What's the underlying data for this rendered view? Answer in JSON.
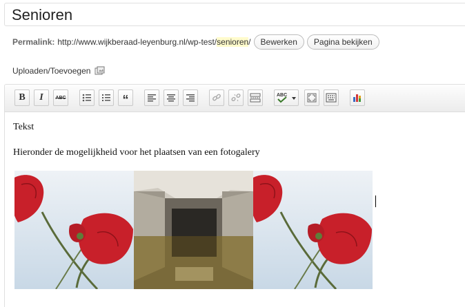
{
  "post": {
    "title": "Senioren"
  },
  "permalink": {
    "label": "Permalink:",
    "url_base": "http://www.wijkberaad-leyenburg.nl/wp-test/",
    "slug": "senioren",
    "trailing_slash": "/",
    "edit_button": "Bewerken",
    "view_button": "Pagina bekijken"
  },
  "upload": {
    "label": "Uploaden/Toevoegen",
    "icon": "media-upload-icon"
  },
  "toolbar": {
    "buttons": [
      {
        "name": "bold-button",
        "icon": "bold-icon",
        "glyph": "B"
      },
      {
        "name": "italic-button",
        "icon": "italic-icon",
        "glyph": "I"
      },
      {
        "name": "strikethrough-button",
        "icon": "strikethrough-icon",
        "glyph": "ABC"
      },
      {
        "name": "bullet-list-button",
        "icon": "bullet-list-icon"
      },
      {
        "name": "numbered-list-button",
        "icon": "numbered-list-icon"
      },
      {
        "name": "blockquote-button",
        "icon": "blockquote-icon",
        "glyph": "“"
      },
      {
        "name": "align-left-button",
        "icon": "align-left-icon"
      },
      {
        "name": "align-center-button",
        "icon": "align-center-icon"
      },
      {
        "name": "align-right-button",
        "icon": "align-right-icon"
      },
      {
        "name": "insert-link-button",
        "icon": "link-icon"
      },
      {
        "name": "remove-link-button",
        "icon": "unlink-icon"
      },
      {
        "name": "insert-more-button",
        "icon": "more-tag-icon"
      },
      {
        "name": "spellcheck-button",
        "icon": "spellcheck-icon",
        "glyph": "ABC"
      },
      {
        "name": "fullscreen-button",
        "icon": "fullscreen-icon"
      },
      {
        "name": "kitchen-sink-button",
        "icon": "kitchen-sink-icon"
      },
      {
        "name": "chart-button",
        "icon": "bar-chart-icon"
      }
    ]
  },
  "content": {
    "paragraph_1": "Tekst",
    "paragraph_2": "Hieronder de mogelijkheid voor het plaatsen van een fotogalery"
  },
  "gallery": {
    "images": [
      {
        "name": "poppy-image-left",
        "subject": "red poppies"
      },
      {
        "name": "pool-image",
        "subject": "empty building reflection in water"
      },
      {
        "name": "poppy-image-right",
        "subject": "red poppies"
      }
    ]
  },
  "colors": {
    "slug_highlight": "#fffbcc",
    "poppy_red": "#c8202a",
    "toolbar_bg": "#ececec"
  }
}
